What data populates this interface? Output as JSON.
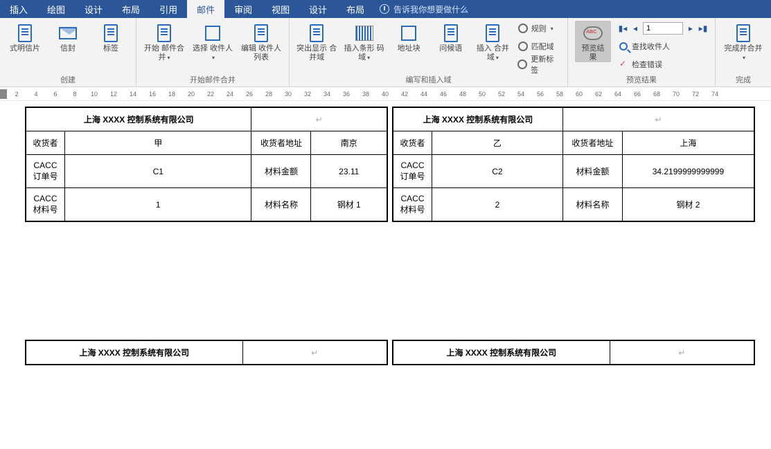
{
  "tabs": [
    "插入",
    "绘图",
    "设计",
    "布局",
    "引用",
    "邮件",
    "审阅",
    "视图",
    "设计",
    "布局"
  ],
  "active_tab_index": 5,
  "tellme_placeholder": "告诉我你想要做什么",
  "ribbon": {
    "create": {
      "postcard": "式明信片",
      "envelope": "信封",
      "label": "标签",
      "group": "创建"
    },
    "start": {
      "start_merge": "开始\n邮件合并",
      "select_recipients": "选择\n收件人",
      "edit_list": "编辑\n收件人列表",
      "group": "开始邮件合并"
    },
    "write": {
      "highlight": "突出显示\n合并域",
      "barcode": "插入条形\n码域",
      "address": "地址块",
      "greeting": "问候语",
      "insert_field": "插入\n合并域",
      "rules": "规则",
      "match": "匹配域",
      "update": "更新标签",
      "group": "编写和插入域"
    },
    "preview": {
      "preview_results": "预览结果",
      "find_recipient": "查找收件人",
      "check_errors": "检查错误",
      "record_value": "1",
      "group": "预览结果"
    },
    "finish": {
      "finish_merge": "完成并合并",
      "group": "完成"
    }
  },
  "ruler_numbers": [
    2,
    4,
    6,
    8,
    10,
    12,
    14,
    16,
    18,
    20,
    22,
    24,
    26,
    28,
    30,
    32,
    34,
    36,
    38,
    40,
    42,
    44,
    46,
    48,
    50,
    52,
    54,
    56,
    58,
    60,
    62,
    64,
    66,
    68,
    70,
    72,
    74
  ],
  "cards": [
    {
      "title": "上海 XXXX 控制系统有限公司",
      "rows": [
        [
          "收货者",
          "甲",
          "收货者地址",
          "南京"
        ],
        [
          "CACC\n订单号",
          "C1",
          "材料金额",
          "23.11"
        ],
        [
          "CACC\n材料号",
          "1",
          "材料名称",
          "钢材 1"
        ]
      ]
    },
    {
      "title": "上海 XXXX 控制系统有限公司",
      "rows": [
        [
          "收货者",
          "乙",
          "收货者地址",
          "上海"
        ],
        [
          "CACC\n订单号",
          "C2",
          "材料金额",
          "34.2199999999999"
        ],
        [
          "CACC\n材料号",
          "2",
          "材料名称",
          "钢材 2"
        ]
      ]
    },
    {
      "title": "上海 XXXX 控制系统有限公司"
    },
    {
      "title": "上海 XXXX 控制系统有限公司"
    }
  ]
}
